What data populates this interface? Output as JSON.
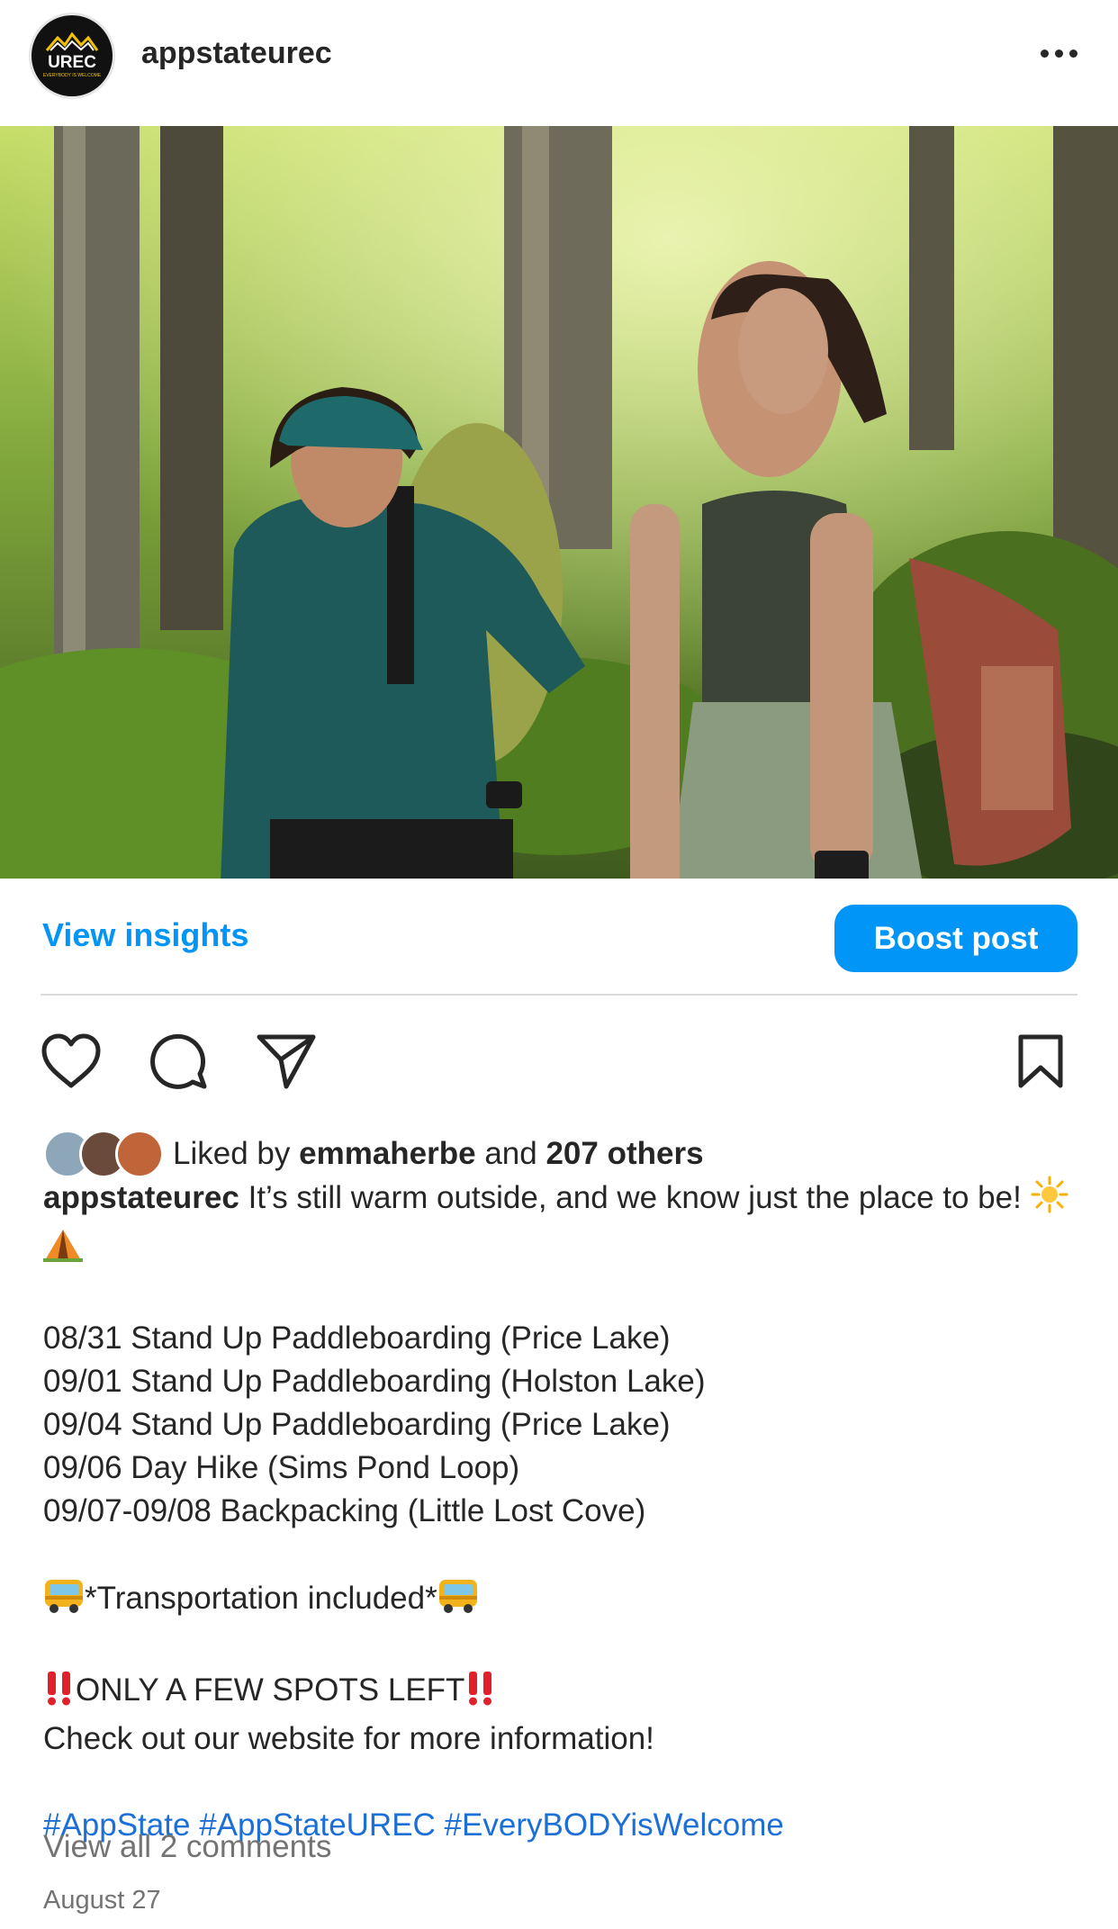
{
  "post": {
    "username": "appstateurec",
    "avatar_label": "UREC",
    "avatar_tagline": "EVERYBODY IS WELCOME"
  },
  "actions": {
    "view_insights": "View insights",
    "boost_post": "Boost post",
    "icons": [
      "heart-icon",
      "comment-icon",
      "share-icon",
      "bookmark-icon"
    ]
  },
  "likes": {
    "prefix": "Liked by",
    "user": "emmaherbe",
    "middle": "and",
    "others": "207 others"
  },
  "caption": {
    "user": "appstateurec",
    "intro": "It’s still warm outside, and we know just the place to be!",
    "events": [
      "08/31 Stand Up Paddleboarding (Price Lake)",
      "09/01 Stand Up Paddleboarding (Holston Lake)",
      "09/04 Stand Up Paddleboarding (Price Lake)",
      "09/06 Day Hike (Sims Pond Loop)",
      "09/07-09/08 Backpacking (Little Lost Cove)"
    ],
    "transport": "*Transportation included*",
    "spots": "ONLY A FEW SPOTS LEFT",
    "website": "Check out our website for more information!",
    "hashtags": "#AppState #AppStateUREC #EveryBODYisWelcome"
  },
  "comments_link": "View all 2 comments",
  "date": "August 27",
  "colors": {
    "accent": "#0095f6",
    "text": "#262626",
    "secondary": "#737373",
    "hashtag": "#1d6fd8"
  }
}
